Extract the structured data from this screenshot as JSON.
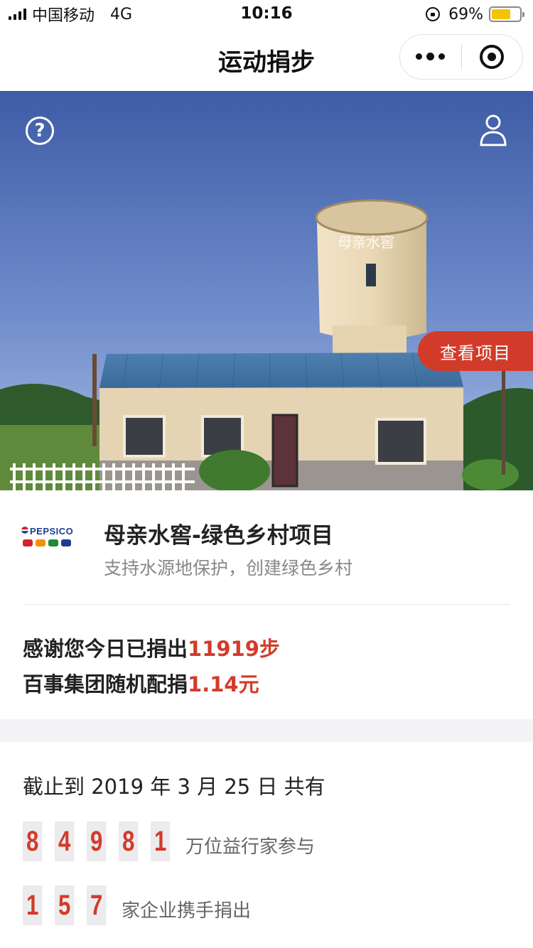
{
  "status_bar": {
    "carrier": "中国移动",
    "network": "4G",
    "time": "10:16",
    "battery": "69%",
    "battery_level": 0.69,
    "icons": [
      "signal-icon",
      "orientation-lock-icon",
      "battery-icon"
    ]
  },
  "nav": {
    "title": "运动捐步",
    "more_icon": "more-dots-icon",
    "close_icon": "close-target-icon"
  },
  "hero": {
    "building_sign": "母亲水窖",
    "view_project_label": "查看项目",
    "help_icon": "question-circle-icon",
    "user_icon": "user-icon"
  },
  "project": {
    "sponsor_logo": "PEPSICO",
    "title": "母亲水窖-绿色乡村项目",
    "subtitle": "支持水源地保护，创建绿色乡村",
    "donated_prefix": "感谢您今日已捐出",
    "donated_steps": "11919步",
    "match_prefix": "百事集团随机配捐",
    "match_amount": "1.14元"
  },
  "stats": {
    "as_of": "截止到 2019 年 3 月 25 日 共有",
    "participants_digits": [
      "8",
      "4",
      "9",
      "8",
      "1"
    ],
    "participants_label": "万位益行家参与",
    "companies_digits": [
      "1",
      "5",
      "7"
    ],
    "companies_label": "家企业携手捐出"
  },
  "colors": {
    "accent": "#d23b2a",
    "battery": "#f5c400"
  }
}
